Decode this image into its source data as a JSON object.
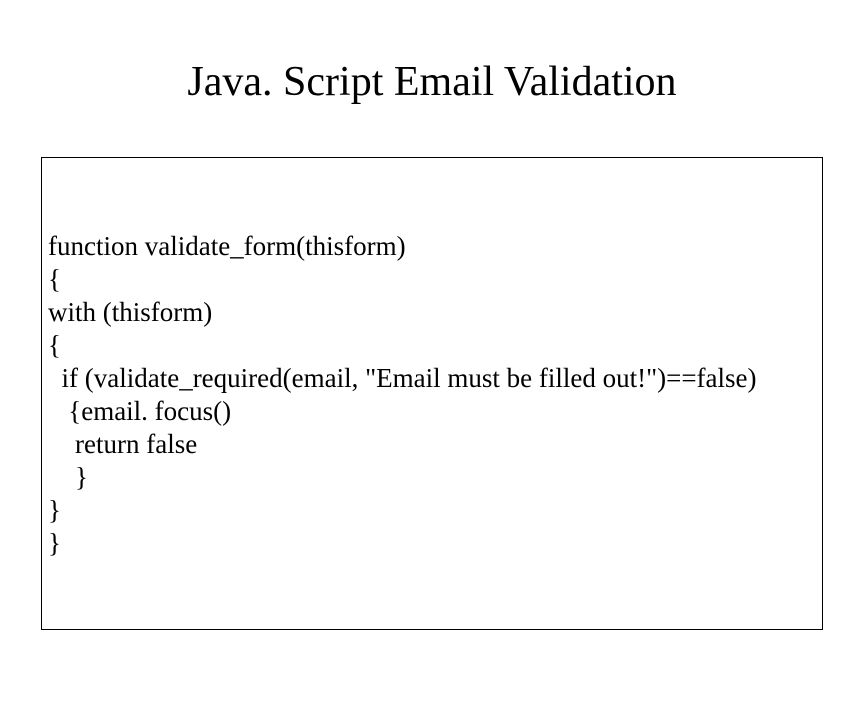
{
  "title": "Java. Script Email Validation",
  "code": {
    "l1": "function validate_form(thisform)",
    "l2": "{",
    "l3": "with (thisform)",
    "l4": "{",
    "l5": "  if (validate_required(email, \"Email must be filled out!\")==false)",
    "l6": "   {email. focus()",
    "l7": "    return false",
    "l8": "    }",
    "l9": "}",
    "l10": "}"
  }
}
